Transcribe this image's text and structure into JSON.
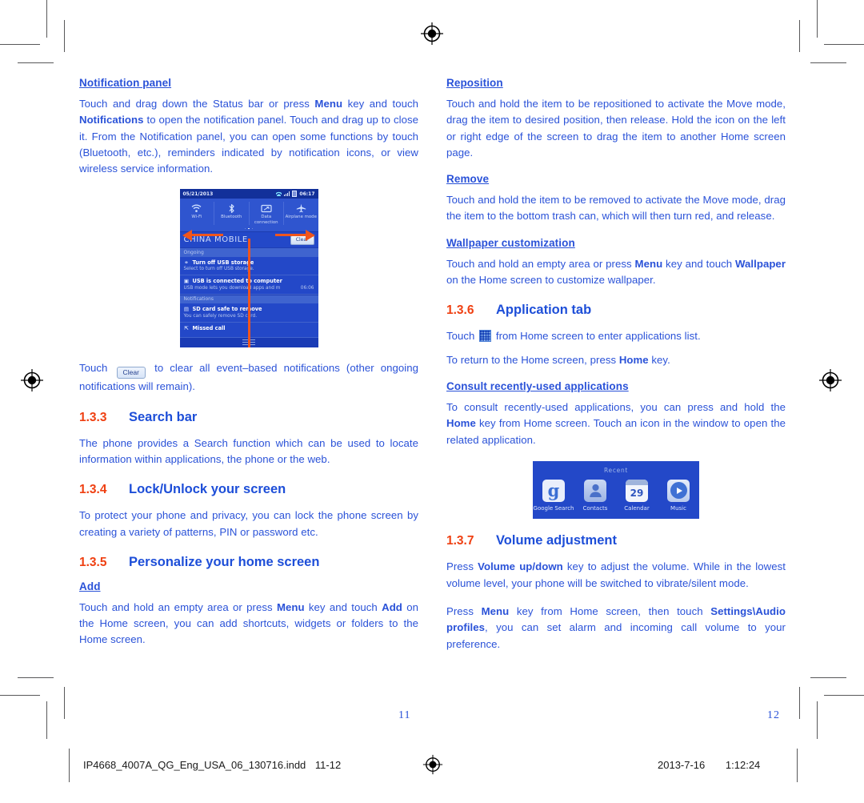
{
  "colors": {
    "body_text": "#2a52d8",
    "section_number": "#ef4012",
    "section_title": "#1d4ed8",
    "screenshot_bg": "#2348c8",
    "arrow": "#f0551c"
  },
  "left_column": {
    "notification_panel": {
      "heading": "Notification panel",
      "paragraph_html": "Touch and drag down the Status bar or press <b>Menu</b> key and touch <b>Notifications</b> to open the notification panel. Touch and drag up to close it. From the Notification panel, you can open some functions by touch (Bluetooth, etc.), reminders indicated by notification icons, or view wireless service information."
    },
    "clear_paragraph": {
      "before": "Touch",
      "button_label": "Clear",
      "after": "to clear all event–based notifications (other ongoing notifications will remain)."
    },
    "sections": [
      {
        "number": "1.3.3",
        "title": "Search bar",
        "body": "The phone provides a Search function which can be used to locate information within applications, the phone or the web."
      },
      {
        "number": "1.3.4",
        "title": "Lock/Unlock your screen",
        "body": "To protect your phone and privacy, you can lock the phone screen by creating a variety of patterns, PIN or password etc."
      },
      {
        "number": "1.3.5",
        "title": "Personalize your home screen"
      }
    ],
    "add": {
      "heading": "Add",
      "paragraph_html": "Touch and hold an empty area or press <b>Menu</b> key and touch <b>Add</b> on the Home screen, you can add shortcuts, widgets or folders to the Home screen."
    }
  },
  "phone_screenshot": {
    "status_bar": {
      "date": "05/21/2013",
      "time": "06:17",
      "icons": [
        "wifi-icon",
        "signal-icon",
        "battery-icon"
      ]
    },
    "toggles": [
      {
        "label": "Wi-Fi",
        "icon": "wifi-icon"
      },
      {
        "label": "Bluetooth",
        "icon": "bluetooth-icon"
      },
      {
        "label": "Data connection",
        "icon": "data-connection-icon"
      },
      {
        "label": "Airplane mode",
        "icon": "airplane-icon"
      }
    ],
    "carrier": "CHINA MOBILE",
    "clear_button": "Clear",
    "group_ongoing": "Ongoing",
    "group_notifications": "Notifications",
    "rows": [
      {
        "title": "Turn off USB storage",
        "subtitle": "Select to turn off USB storage.",
        "clock": "",
        "icon": "usb-icon"
      },
      {
        "title": "USB is connected to computer",
        "subtitle": "USB mode lets you download apps and m",
        "clock": "06:06",
        "icon": "usb-connected-icon"
      },
      {
        "title": "SD card safe to remove",
        "subtitle": "You can safely remove SD card.",
        "clock": "",
        "icon": "sdcard-icon"
      },
      {
        "title": "Missed call",
        "subtitle": "",
        "clock": "",
        "icon": "missed-call-icon"
      }
    ]
  },
  "right_column": {
    "reposition": {
      "heading": "Reposition ",
      "body": "Touch and hold the item to be repositioned to activate the Move mode, drag the item to desired position, then release. Hold the icon on the left or right edge of the screen to drag the item to another Home screen page."
    },
    "remove": {
      "heading": "Remove",
      "body": "Touch and hold the item to be removed to activate the Move mode, drag the item to the bottom trash can, which will then turn red, and release."
    },
    "wallpaper": {
      "heading": "Wallpaper customization",
      "paragraph_html": "Touch and hold an empty area or press <b>Menu</b> key and touch <b>Wallpaper</b> on the Home screen to customize wallpaper."
    },
    "application_tab": {
      "number": "1.3.6",
      "title": "Application tab",
      "line1_before": "Touch",
      "line1_after": "from Home screen to enter applications list.",
      "line2_html": "To return to the Home screen, press <b>Home</b> key."
    },
    "consult": {
      "heading": "Consult recently-used applications",
      "paragraph_html": "To consult recently-used applications, you can press and hold the <b>Home</b> key from Home screen. Touch an icon in the window to open the related application."
    },
    "volume": {
      "number": "1.3.7",
      "title": "Volume adjustment",
      "paragraph1_html": "Press <b>Volume up/down</b> key to adjust the volume. While in the lowest volume level, your phone will be switched to vibrate/silent mode.",
      "paragraph2_html": "Press <b>Menu</b> key from Home screen, then touch <b>Settings\\Audio profiles</b>, you can set alarm and incoming call volume to your preference."
    }
  },
  "recent_screenshot": {
    "title": "Recent",
    "apps": [
      {
        "label": "Google Search",
        "icon": "google-search-icon",
        "glyph": "g"
      },
      {
        "label": "Contacts",
        "icon": "contacts-icon",
        "glyph": ""
      },
      {
        "label": "Calendar",
        "icon": "calendar-icon",
        "glyph": "29"
      },
      {
        "label": "Music",
        "icon": "music-icon",
        "glyph": ""
      }
    ]
  },
  "page_numbers": {
    "left": "11",
    "right": "12"
  },
  "print_footer": {
    "filename": "IP4668_4007A_QG_Eng_USA_06_130716.indd",
    "pages": "11-12",
    "date": "2013-7-16",
    "time": "1:12:24"
  }
}
